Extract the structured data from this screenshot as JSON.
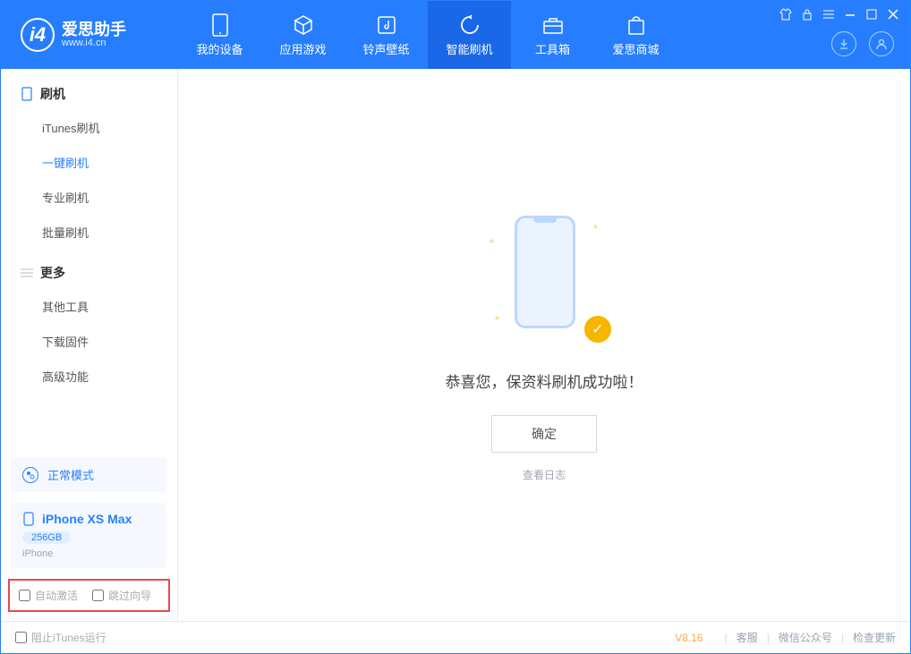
{
  "app": {
    "name_cn": "爱思助手",
    "url": "www.i4.cn"
  },
  "nav": {
    "tabs": [
      "我的设备",
      "应用游戏",
      "铃声壁纸",
      "智能刷机",
      "工具箱",
      "爱思商城"
    ],
    "active_index": 3
  },
  "sidebar": {
    "group_flash": {
      "title": "刷机",
      "items": [
        "iTunes刷机",
        "一键刷机",
        "专业刷机",
        "批量刷机"
      ],
      "active_index": 1
    },
    "group_more": {
      "title": "更多",
      "items": [
        "其他工具",
        "下载固件",
        "高级功能"
      ]
    },
    "mode_label": "正常模式",
    "device": {
      "name": "iPhone XS Max",
      "capacity": "256GB",
      "type": "iPhone"
    },
    "options": {
      "auto_activate": "自动激活",
      "skip_guide": "跳过向导"
    }
  },
  "main": {
    "success_msg": "恭喜您，保资料刷机成功啦！",
    "ok_button": "确定",
    "view_log": "查看日志"
  },
  "footer": {
    "block_itunes": "阻止iTunes运行",
    "version": "V8.16",
    "links": [
      "客服",
      "微信公众号",
      "检查更新"
    ]
  }
}
